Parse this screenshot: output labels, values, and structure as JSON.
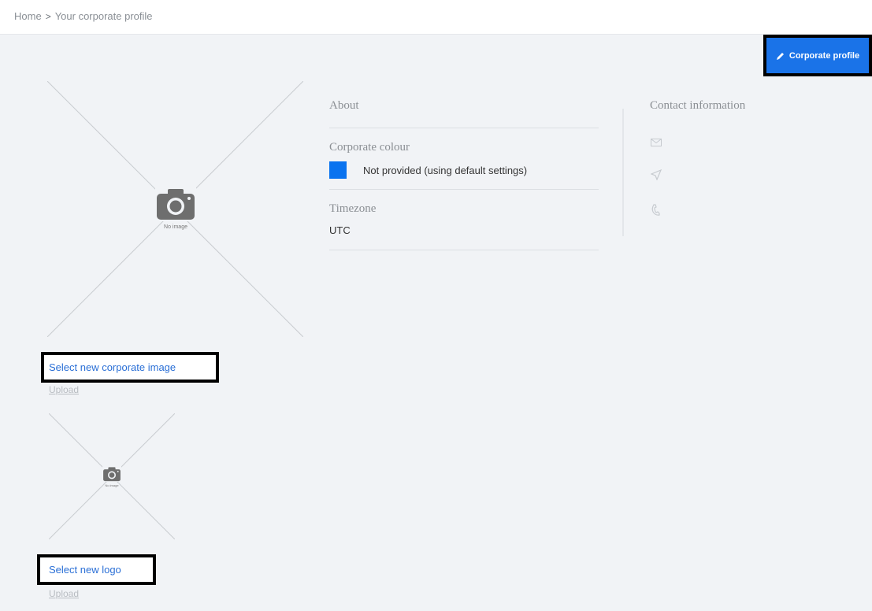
{
  "breadcrumb": {
    "home": "Home",
    "separator": ">",
    "current": "Your corporate profile"
  },
  "header": {
    "edit_button_label": "Corporate profile",
    "edit_button_icon": "pencil-icon",
    "accent_color": "#1a73e8"
  },
  "corporate_image": {
    "placeholder_caption": "No image",
    "select_link": "Select new corporate image",
    "upload_link": "Upload"
  },
  "logo": {
    "placeholder_caption": "No image",
    "select_link": "Select new logo",
    "upload_link": "Upload"
  },
  "about": {
    "title": "About",
    "corporate_colour_label": "Corporate colour",
    "corporate_colour_value": "Not provided (using default settings)",
    "corporate_colour_swatch": "#0a73ef",
    "timezone_label": "Timezone",
    "timezone_value": "UTC"
  },
  "contact": {
    "title": "Contact information",
    "icons": [
      "email-icon",
      "location-icon",
      "phone-icon"
    ]
  }
}
